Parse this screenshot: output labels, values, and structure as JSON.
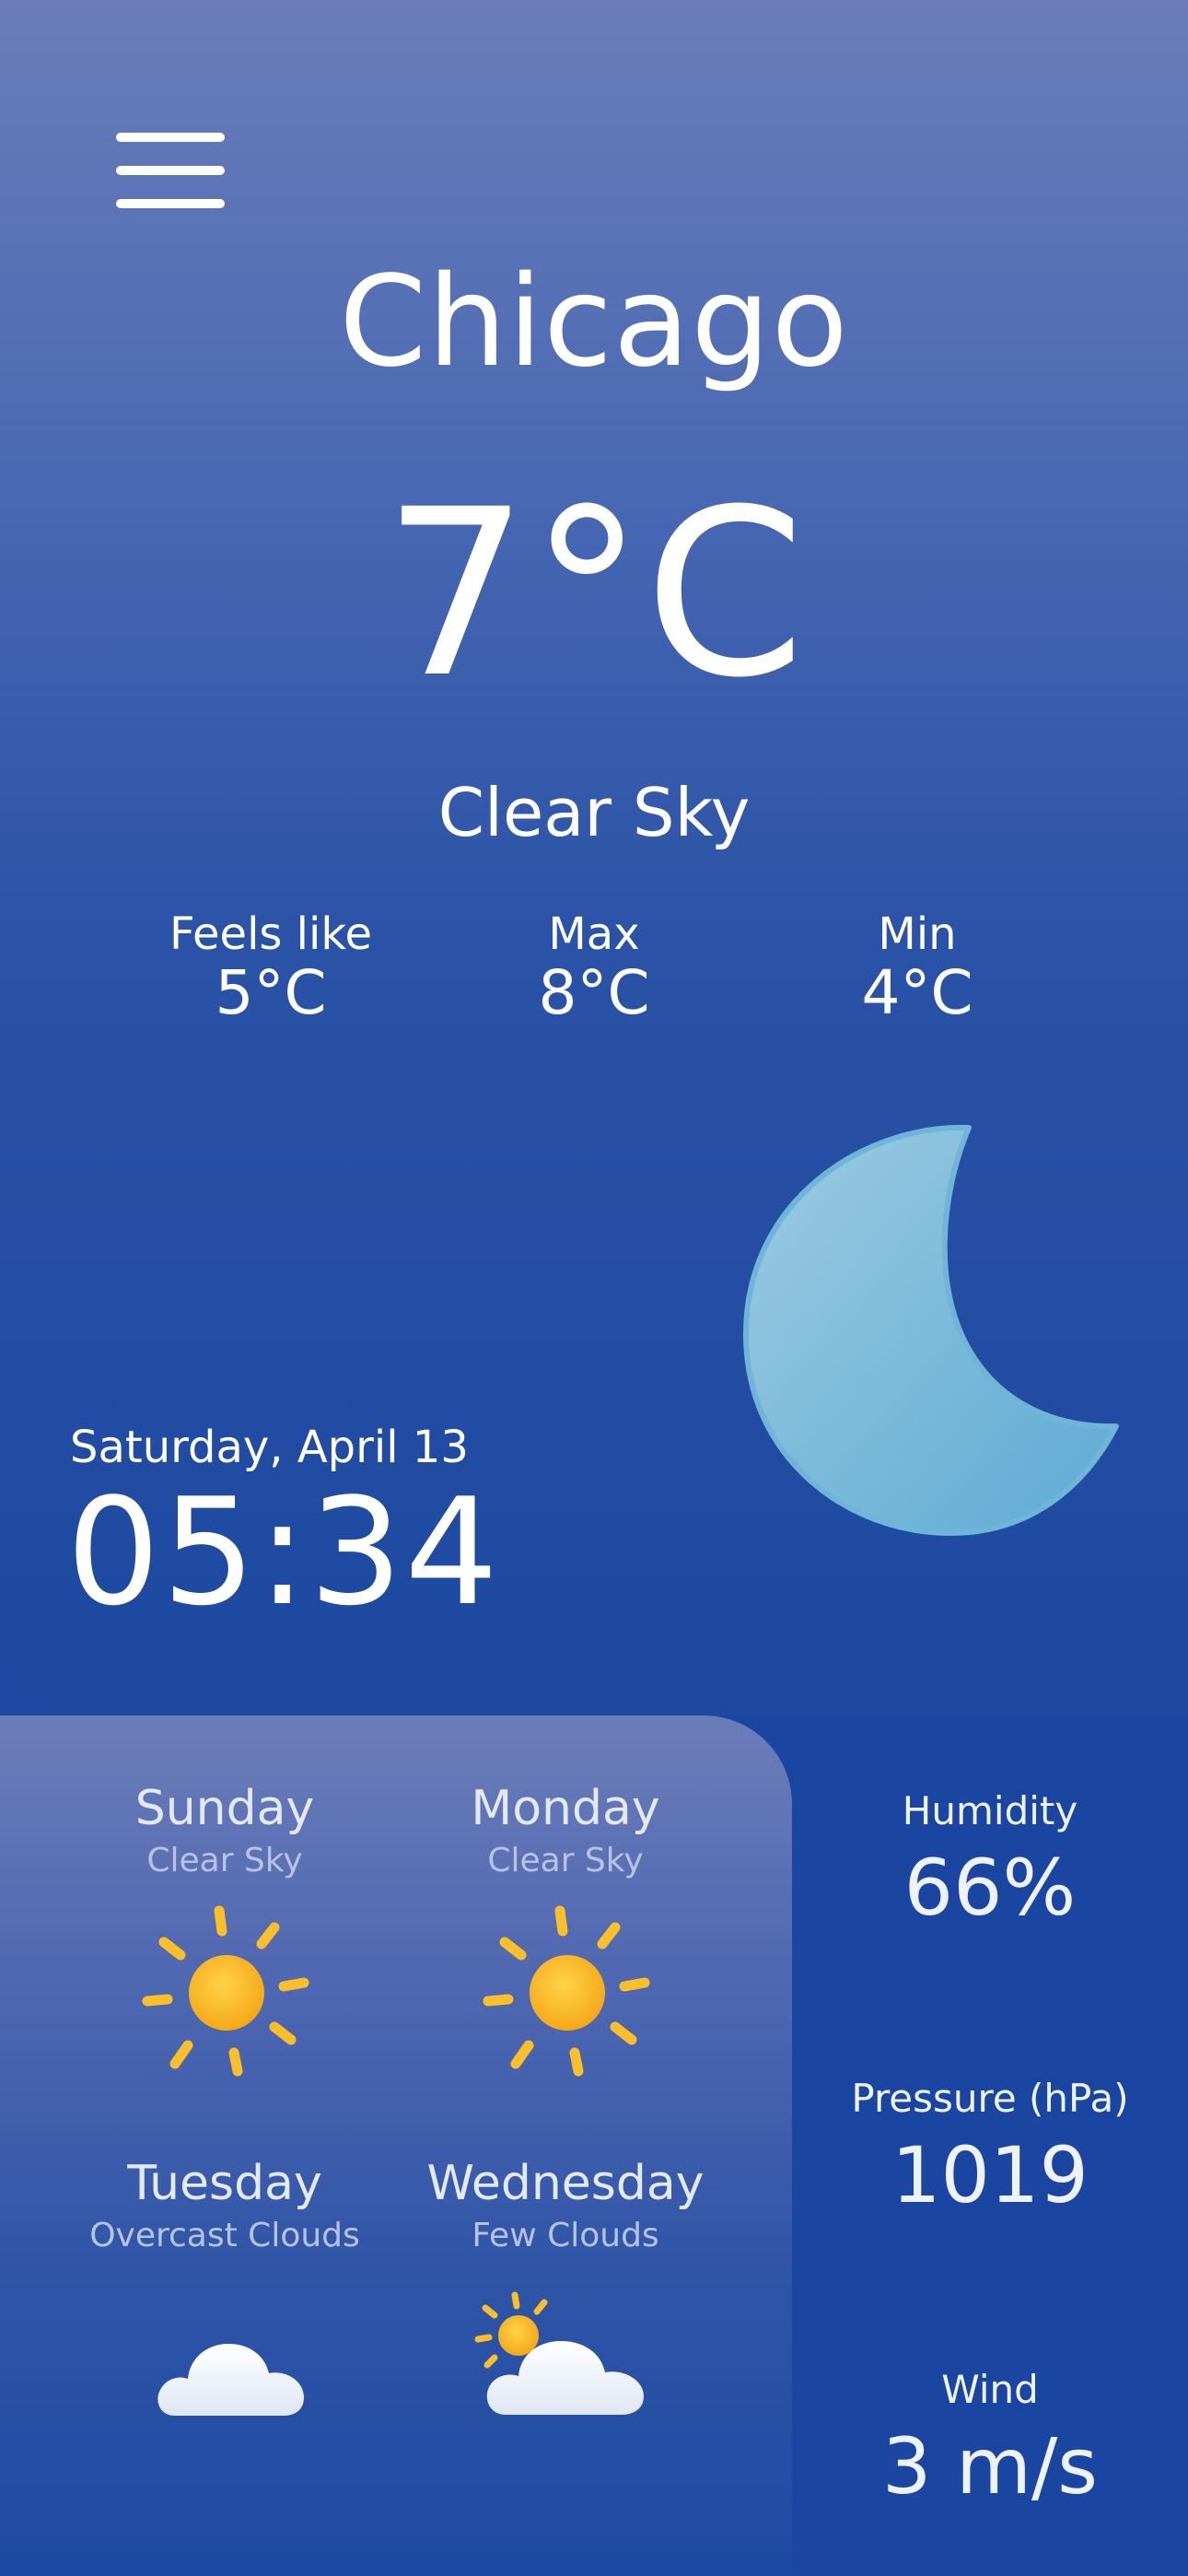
{
  "header": {
    "menu_icon": "hamburger-menu-icon",
    "city": "Chicago"
  },
  "current": {
    "temperature": "7°C",
    "condition": "Clear Sky",
    "feels_like": {
      "label": "Feels like",
      "value": "5°C"
    },
    "max": {
      "label": "Max",
      "value": "8°C"
    },
    "min": {
      "label": "Min",
      "value": "4°C"
    },
    "icon": "moon-icon"
  },
  "datetime": {
    "date": "Saturday, April 13",
    "time": "05:34"
  },
  "forecast": [
    {
      "day": "Sunday",
      "description": "Clear Sky",
      "icon": "sun-icon"
    },
    {
      "day": "Monday",
      "description": "Clear Sky",
      "icon": "sun-icon"
    },
    {
      "day": "Tuesday",
      "description": "Overcast Clouds",
      "icon": "cloud-icon"
    },
    {
      "day": "Wednesday",
      "description": "Few Clouds",
      "icon": "sun-behind-cloud-icon"
    }
  ],
  "stats": {
    "humidity": {
      "label": "Humidity",
      "value": "66%"
    },
    "pressure": {
      "label": "Pressure (hPa)",
      "value": "1019"
    },
    "wind": {
      "label": "Wind",
      "value": "3 m/s"
    }
  },
  "colors": {
    "background_top": "#6a7db8",
    "background_bottom": "#1a47a0",
    "moon": "#8bc3de",
    "sun": "#fbb829",
    "cloud": "#f2f6fc"
  }
}
